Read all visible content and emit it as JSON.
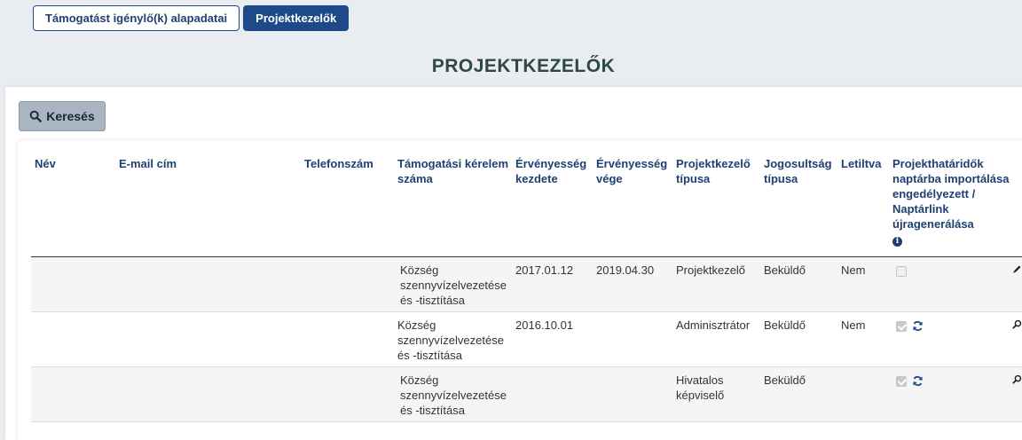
{
  "tabs": [
    {
      "label": "Támogatást igénylő(k) alapadatai",
      "active": false
    },
    {
      "label": "Projektkezelők",
      "active": true
    }
  ],
  "page_title": "PROJEKTKEZELŐK",
  "search_label": "Keresés",
  "table": {
    "headers": {
      "name": "Név",
      "email": "E-mail cím",
      "phone": "Telefonszám",
      "application_number": "Támogatási kérelem száma",
      "valid_from": "Érvényesség kezdete",
      "valid_to": "Érvényesség vége",
      "manager_type": "Projektkezelő típusa",
      "permission_type": "Jogosultság típusa",
      "disabled": "Letiltva",
      "calendar": "Projekthatáridők naptárba importálása engedélyezett / Naptárlink újragenerálása"
    },
    "rows": [
      {
        "name": "",
        "email": "",
        "phone": "",
        "application_number": "Község szennyvízelvezetése és -tisztítása",
        "valid_from": "2017.01.12",
        "valid_to": "2019.04.30",
        "manager_type": "Projektkezelő",
        "permission_type": "Beküldő",
        "disabled": "Nem",
        "calendar_checked": false,
        "refresh": false,
        "action_icon": "pencil-icon"
      },
      {
        "name": "",
        "email": "",
        "phone": "",
        "application_number": "Község szennyvízelvezetése és -tisztítása",
        "valid_from": "2016.10.01",
        "valid_to": "",
        "manager_type": "Adminisztrátor",
        "permission_type": "Beküldő",
        "disabled": "Nem",
        "calendar_checked": true,
        "refresh": true,
        "action_icon": "magnifier-icon"
      },
      {
        "name": "",
        "email": "",
        "phone": "",
        "application_number": "Község szennyvízelvezetése és -tisztítása",
        "valid_from": "",
        "valid_to": "",
        "manager_type": "Hivatalos képviselő",
        "permission_type": "Beküldő",
        "disabled": "",
        "calendar_checked": true,
        "refresh": true,
        "action_icon": "magnifier-icon"
      }
    ]
  },
  "colors": {
    "primary": "#1f4a8a",
    "title": "#2e4a40",
    "search_bg": "#a9b5c2"
  }
}
